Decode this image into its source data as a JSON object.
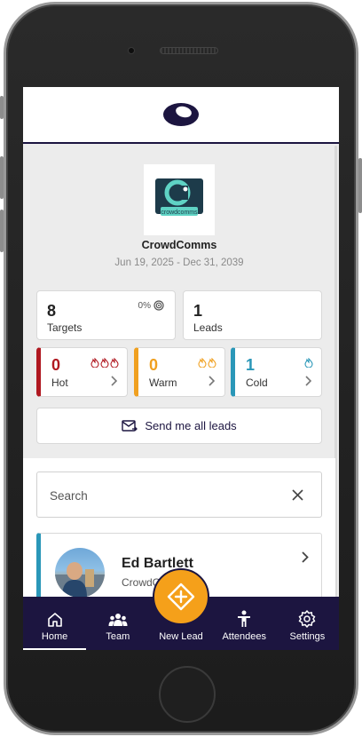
{
  "event": {
    "logo_text": "crowdcomms",
    "name": "CrowdComms",
    "dates": "Jun 19, 2025 - Dec 31, 2039"
  },
  "stats": {
    "targets": {
      "value": "8",
      "label": "Targets",
      "percent": "0%"
    },
    "leads": {
      "value": "1",
      "label": "Leads"
    }
  },
  "temperature": {
    "hot": {
      "value": "0",
      "label": "Hot",
      "color": "#b01820"
    },
    "warm": {
      "value": "0",
      "label": "Warm",
      "color": "#f0a020"
    },
    "cold": {
      "value": "1",
      "label": "Cold",
      "color": "#2a97b8"
    }
  },
  "send_leads_label": "Send me all leads",
  "search": {
    "placeholder": "Search"
  },
  "lead": {
    "name": "Ed Bartlett",
    "company": "CrowdC"
  },
  "nav": {
    "home": "Home",
    "team": "Team",
    "new_lead": "New Lead",
    "attendees": "Attendees",
    "settings": "Settings"
  },
  "colors": {
    "brand_navy": "#1c1540",
    "accent_orange": "#f5a01a"
  }
}
